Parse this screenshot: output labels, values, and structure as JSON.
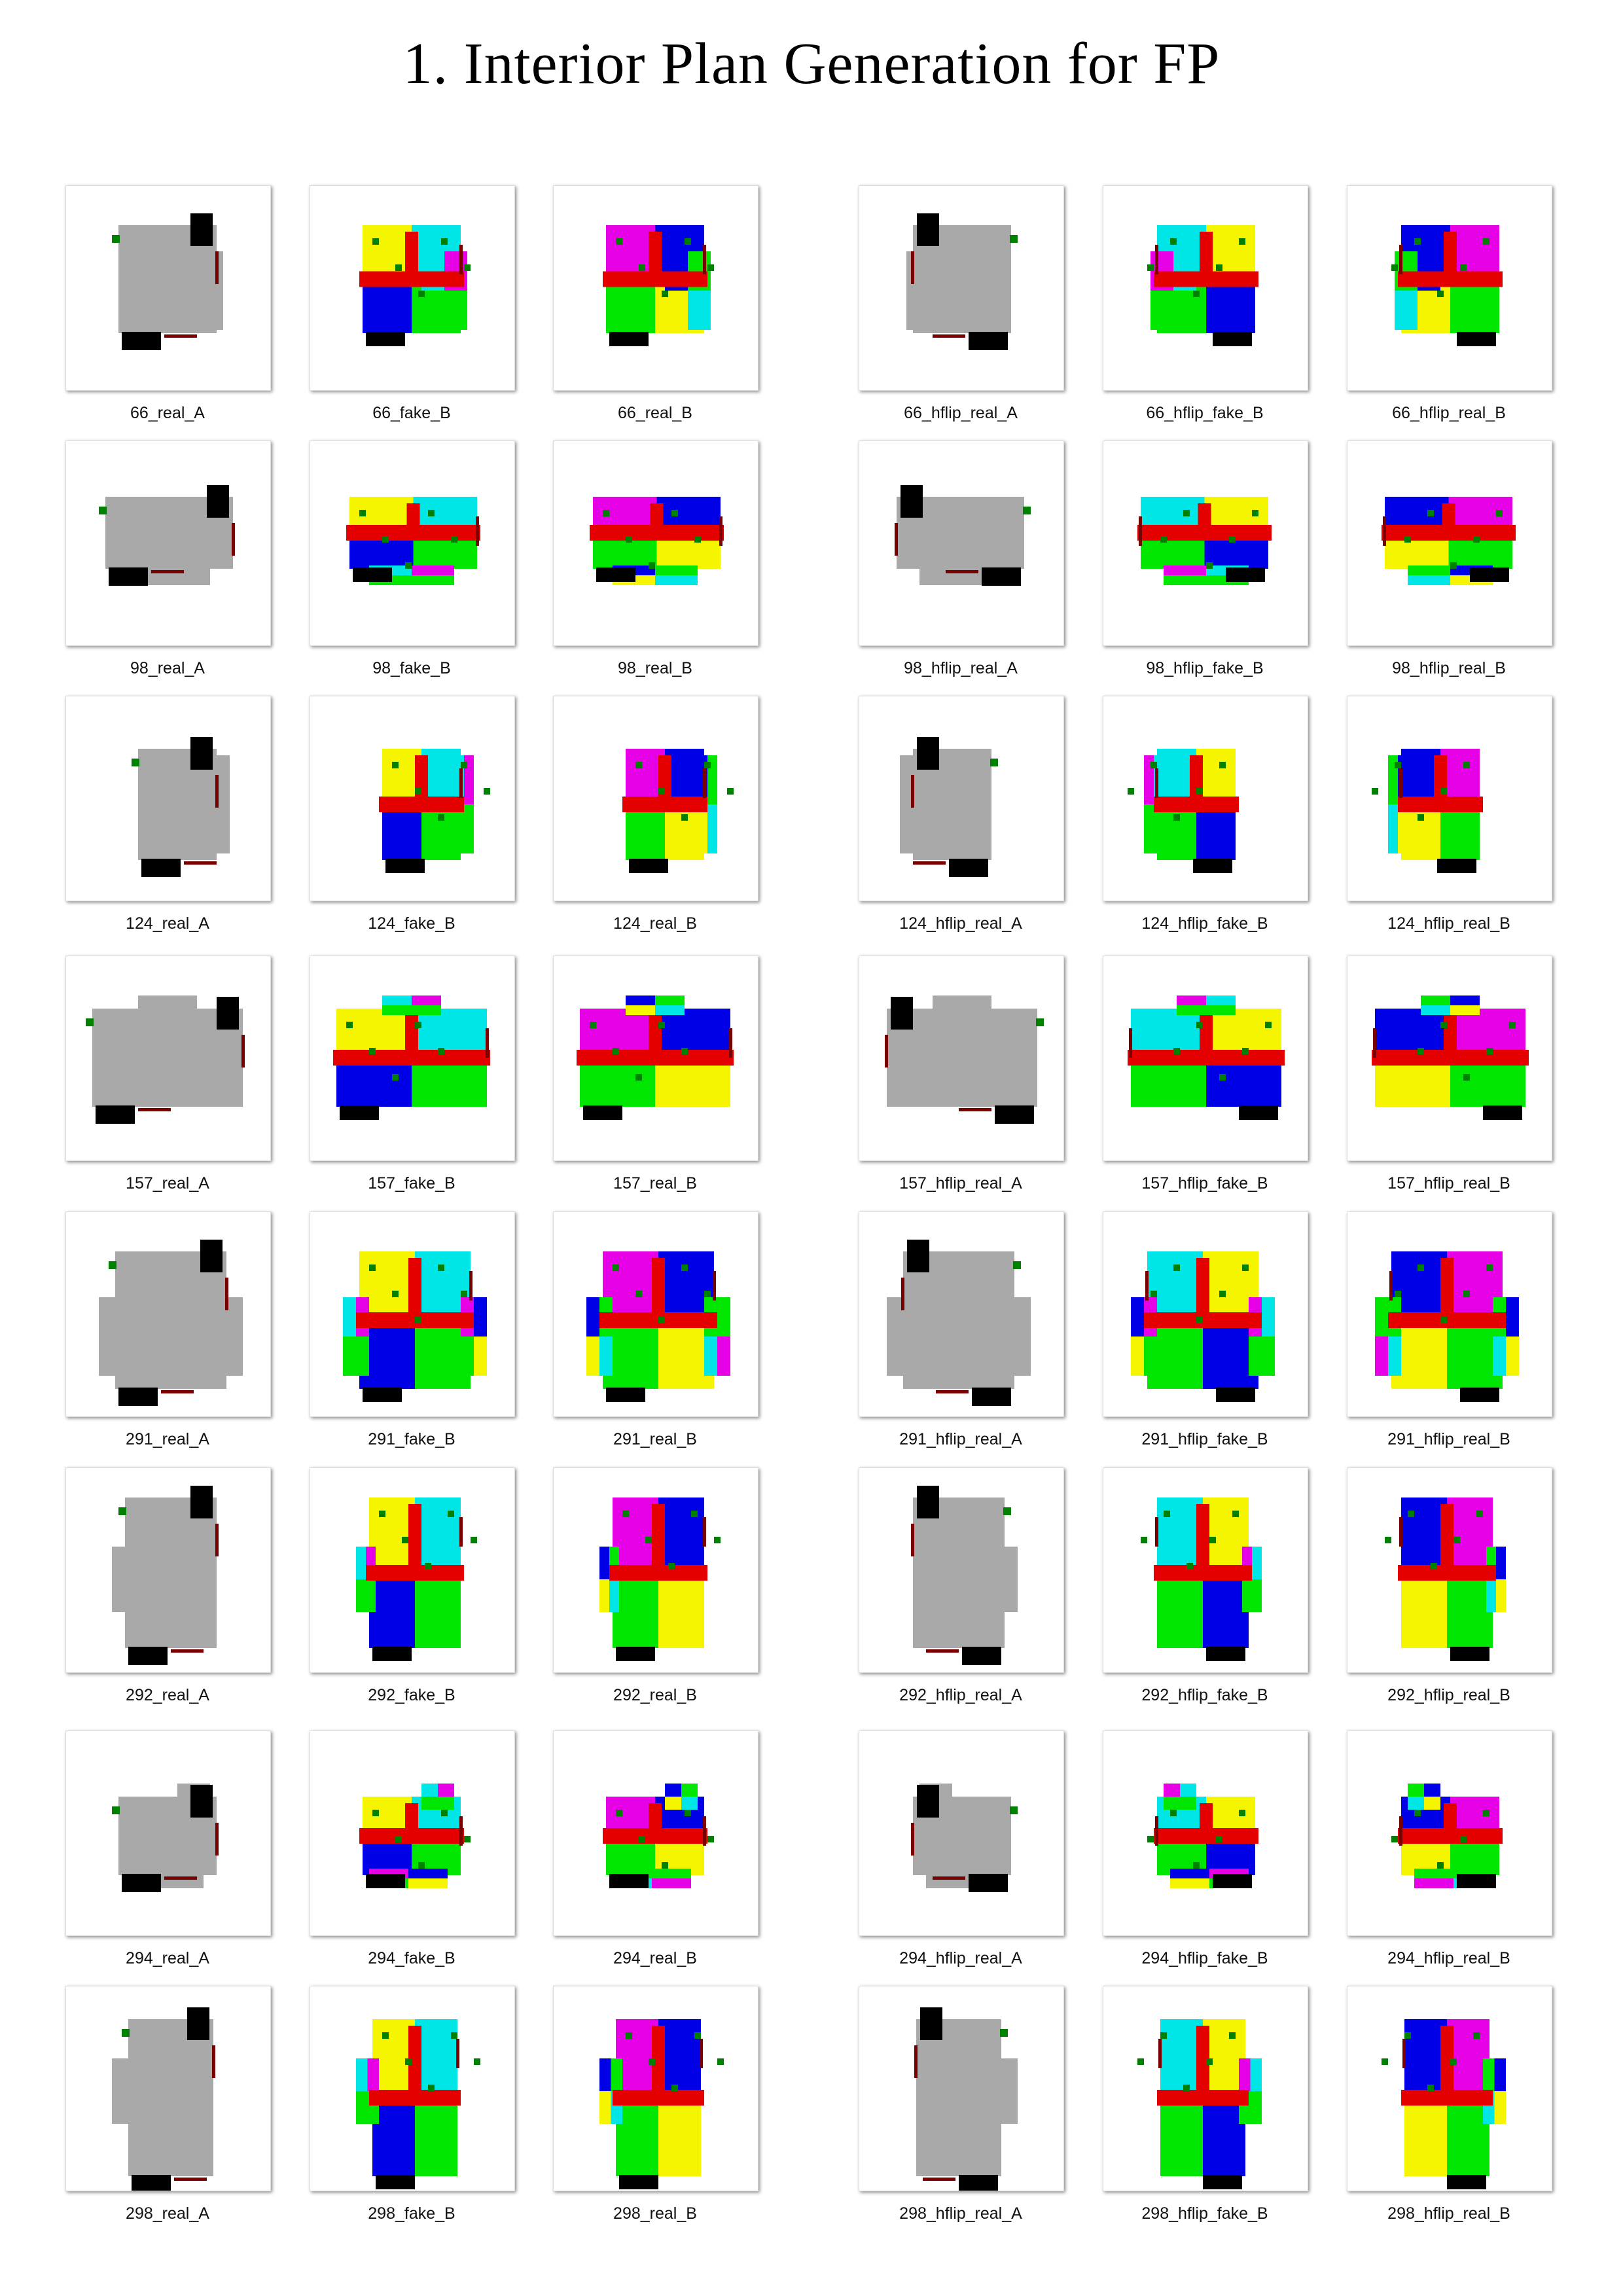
{
  "page": {
    "title": "1. Interior Plan Generation for FP"
  },
  "palette": {
    "gray": "#a9a9a9",
    "red": "#e50000",
    "blue": "#0000e6",
    "green": "#00e600",
    "cyan": "#00e6e6",
    "yellow": "#f5f500",
    "magenta": "#e600e6",
    "black": "#000000",
    "dark_red": "#7a0000",
    "dark_green": "#008000"
  },
  "rows": [
    {
      "id": "66",
      "labels": [
        "66_real_A",
        "66_fake_B",
        "66_real_B",
        "66_hflip_real_A",
        "66_hflip_fake_B",
        "66_hflip_real_B"
      ]
    },
    {
      "id": "98",
      "labels": [
        "98_real_A",
        "98_fake_B",
        "98_real_B",
        "98_hflip_real_A",
        "98_hflip_fake_B",
        "98_hflip_real_B"
      ]
    },
    {
      "id": "124",
      "labels": [
        "124_real_A",
        "124_fake_B",
        "124_real_B",
        "124_hflip_real_A",
        "124_hflip_fake_B",
        "124_hflip_real_B"
      ]
    },
    {
      "id": "157",
      "labels": [
        "157_real_A",
        "157_fake_B",
        "157_real_B",
        "157_hflip_real_A",
        "157_hflip_fake_B",
        "157_hflip_real_B"
      ]
    },
    {
      "id": "291",
      "labels": [
        "291_real_A",
        "291_fake_B",
        "291_real_B",
        "291_hflip_real_A",
        "291_hflip_fake_B",
        "291_hflip_real_B"
      ]
    },
    {
      "id": "292",
      "labels": [
        "292_real_A",
        "292_fake_B",
        "292_real_B",
        "292_hflip_real_A",
        "292_hflip_fake_B",
        "292_hflip_real_B"
      ]
    },
    {
      "id": "294",
      "labels": [
        "294_real_A",
        "294_fake_B",
        "294_real_B",
        "294_hflip_real_A",
        "294_hflip_fake_B",
        "294_hflip_real_B"
      ]
    },
    {
      "id": "298",
      "labels": [
        "298_real_A",
        "298_fake_B",
        "298_real_B",
        "298_hflip_real_A",
        "298_hflip_fake_B",
        "298_hflip_real_B"
      ]
    }
  ]
}
